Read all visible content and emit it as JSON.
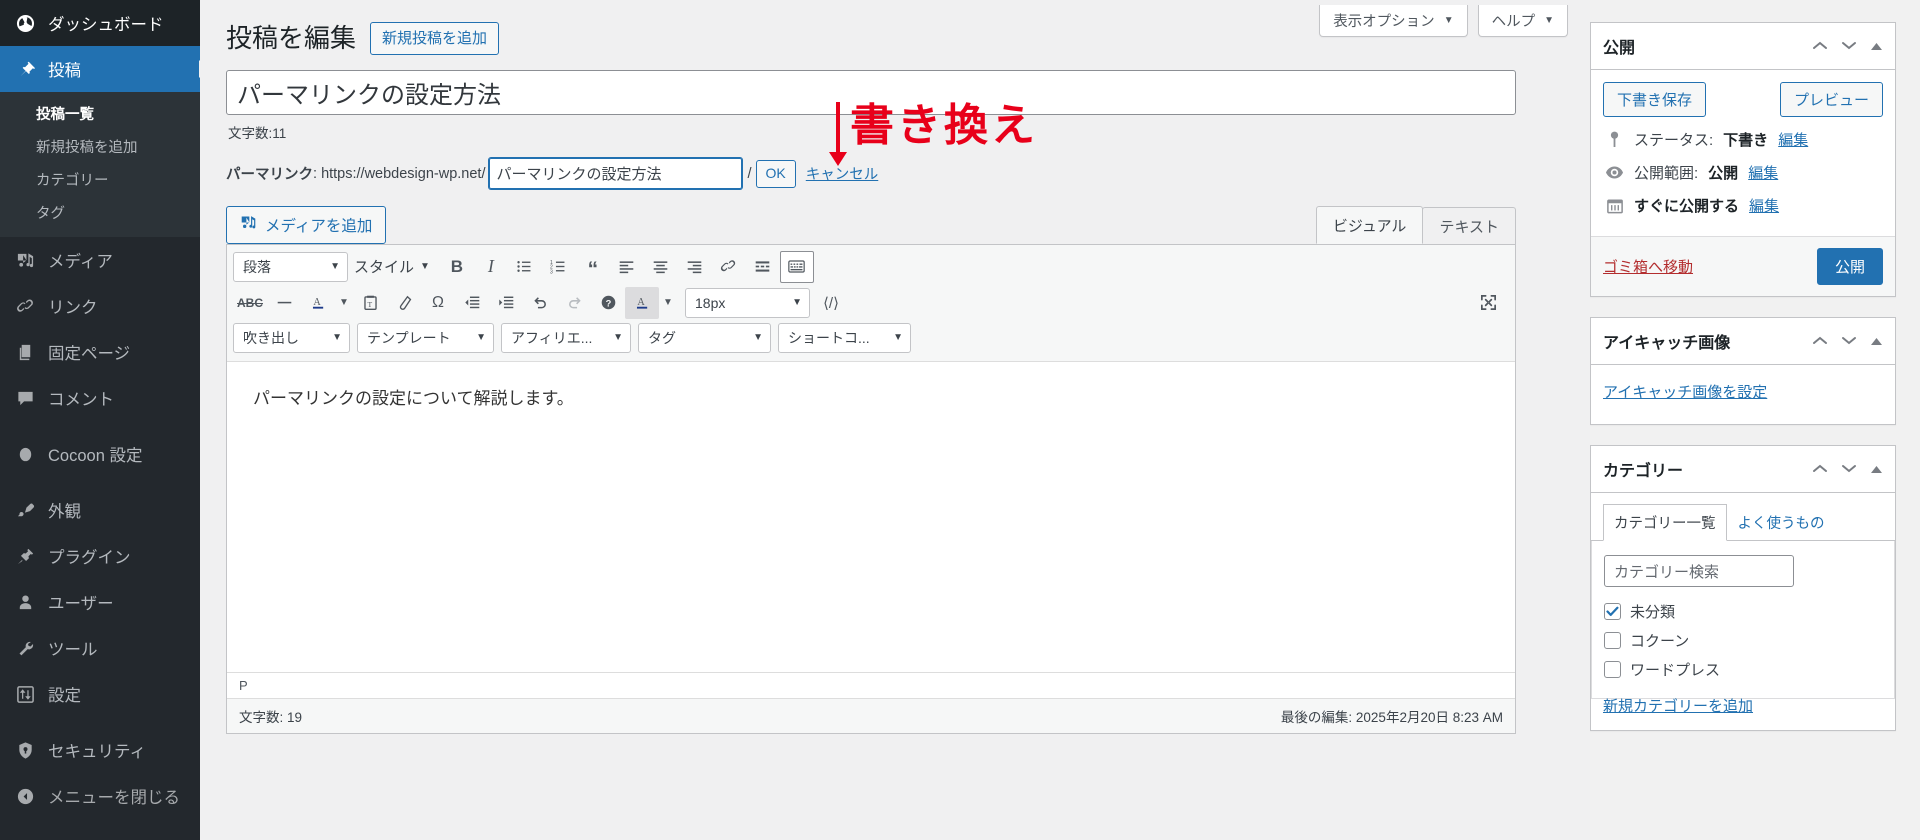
{
  "sidebar": {
    "items": [
      {
        "label": "ダッシュボード",
        "icon": "dashboard-icon",
        "state": "top"
      },
      {
        "label": "投稿",
        "icon": "pin-icon",
        "state": "current"
      },
      {
        "label": "メディア",
        "icon": "media-icon",
        "state": "normal"
      },
      {
        "label": "リンク",
        "icon": "link-icon",
        "state": "normal"
      },
      {
        "label": "固定ページ",
        "icon": "page-icon",
        "state": "normal"
      },
      {
        "label": "コメント",
        "icon": "comment-icon",
        "state": "normal"
      },
      {
        "label": "Cocoon 設定",
        "icon": "cocoon-icon",
        "state": "normal"
      },
      {
        "label": "外観",
        "icon": "appearance-icon",
        "state": "normal"
      },
      {
        "label": "プラグイン",
        "icon": "plugin-icon",
        "state": "normal"
      },
      {
        "label": "ユーザー",
        "icon": "user-icon",
        "state": "normal"
      },
      {
        "label": "ツール",
        "icon": "tools-icon",
        "state": "normal"
      },
      {
        "label": "設定",
        "icon": "settings-icon",
        "state": "normal"
      },
      {
        "label": "セキュリティ",
        "icon": "security-icon",
        "state": "normal"
      },
      {
        "label": "メニューを閉じる",
        "icon": "collapse-icon",
        "state": "normal"
      }
    ],
    "submenu": [
      "投稿一覧",
      "新規投稿を追加",
      "カテゴリー",
      "タグ"
    ]
  },
  "header": {
    "screen_options": "表示オプション",
    "help": "ヘルプ",
    "caret": "▼"
  },
  "page": {
    "title": "投稿を編集",
    "add_new": "新規投稿を追加",
    "post_title": "パーマリンクの設定方法",
    "char_count_title": "文字数:11",
    "permalink_label": "パーマリンク",
    "permalink_base": "https://webdesign-wp.net/",
    "permalink_slug": "パーマリンクの設定方法",
    "permalink_trailing_slash": "/",
    "ok": "OK",
    "cancel": "キャンセル"
  },
  "annotation": {
    "text": "書き換え",
    "color": "#e8001a",
    "arrow": "down-arrow"
  },
  "editor": {
    "add_media": "メディアを追加",
    "tabs": [
      {
        "label": "ビジュアル",
        "active": true
      },
      {
        "label": "テキスト",
        "active": false
      }
    ],
    "toolbar_row1": {
      "format_select": "段落",
      "styles": "スタイル",
      "buttons": [
        "bold-icon",
        "italic-icon",
        "bulleted-list-icon",
        "numbered-list-icon",
        "blockquote-icon",
        "align-left-icon",
        "align-center-icon",
        "align-right-icon",
        "link-icon",
        "more-tag-icon",
        "toolbar-toggle-icon"
      ]
    },
    "toolbar_row2": {
      "buttons": [
        "strikethrough-icon",
        "horizontal-rule-icon",
        "text-color-icon",
        "paste-as-text-icon",
        "clear-formatting-icon",
        "special-character-icon",
        "decrease-indent-icon",
        "increase-indent-icon",
        "undo-icon",
        "redo-icon",
        "help-icon",
        "background-color-icon",
        "source-code-icon"
      ],
      "font_size": "18px"
    },
    "toolbar_row3": [
      "吹き出し",
      "テンプレート",
      "アフィリエ...",
      "タグ",
      "ショートコ..."
    ],
    "content": "パーマリンクの設定について解説します。",
    "path": "P",
    "char_count": "文字数: 19",
    "last_edit": "最後の編集: 2025年2月20日 8:23 AM",
    "fullscreen": "fullscreen-icon"
  },
  "publish_box": {
    "title": "公開",
    "save_draft": "下書き保存",
    "preview": "プレビュー",
    "status_label": "ステータス:",
    "status_value": "下書き",
    "visibility_label": "公開範囲:",
    "visibility_value": "公開",
    "schedule": "すぐに公開する",
    "edit": "編集",
    "trash": "ゴミ箱へ移動",
    "publish": "公開"
  },
  "featured_box": {
    "title": "アイキャッチ画像",
    "set_link": "アイキャッチ画像を設定"
  },
  "category_box": {
    "title": "カテゴリー",
    "tabs": [
      {
        "label": "カテゴリー一覧",
        "active": true
      },
      {
        "label": "よく使うもの",
        "active": false
      }
    ],
    "search_placeholder": "カテゴリー検索",
    "items": [
      {
        "label": "未分類",
        "checked": true
      },
      {
        "label": "コクーン",
        "checked": false
      },
      {
        "label": "ワードプレス",
        "checked": false
      }
    ],
    "add_new": "新規カテゴリーを追加"
  }
}
